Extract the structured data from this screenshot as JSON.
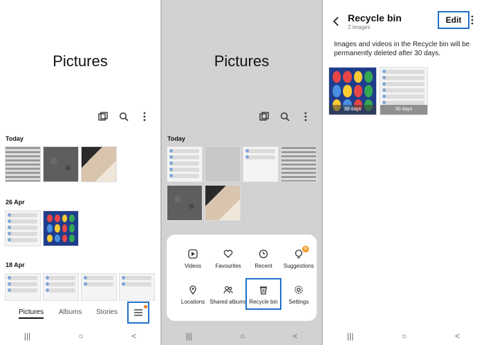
{
  "screen1": {
    "title": "Pictures",
    "section_today": "Today",
    "section_apr26": "26 Apr",
    "section_apr18": "18 Apr",
    "tabs": [
      "Pictures",
      "Albums",
      "Stories"
    ],
    "active_tab": "Pictures",
    "icons": [
      "select-icon",
      "search-icon",
      "more-icon",
      "menu-icon"
    ]
  },
  "screen2": {
    "title": "Pictures",
    "section_today": "Today",
    "menu_items": [
      {
        "label": "Videos",
        "icon": "video-icon"
      },
      {
        "label": "Favourites",
        "icon": "heart-icon"
      },
      {
        "label": "Recent",
        "icon": "clock-icon"
      },
      {
        "label": "Suggestions",
        "icon": "bulb-icon",
        "badge": "N"
      },
      {
        "label": "Locations",
        "icon": "pin-icon"
      },
      {
        "label": "Shared albums",
        "icon": "people-icon"
      },
      {
        "label": "Recycle bin",
        "icon": "trash-icon"
      },
      {
        "label": "Settings",
        "icon": "gear-icon"
      }
    ]
  },
  "screen3": {
    "title": "Recycle bin",
    "subtitle": "2 images",
    "edit_label": "Edit",
    "message": "Images and videos in the Recycle bin will be permanently deleted after 30 days.",
    "thumbs": [
      {
        "label": "30 days"
      },
      {
        "label": "30 days"
      }
    ]
  },
  "navbar": [
    "|||",
    "○",
    "<"
  ],
  "colors": {
    "highlight": "#1f6fc9",
    "badge": "#f0a030",
    "panel_bg_dim": "#d2d2d2"
  }
}
